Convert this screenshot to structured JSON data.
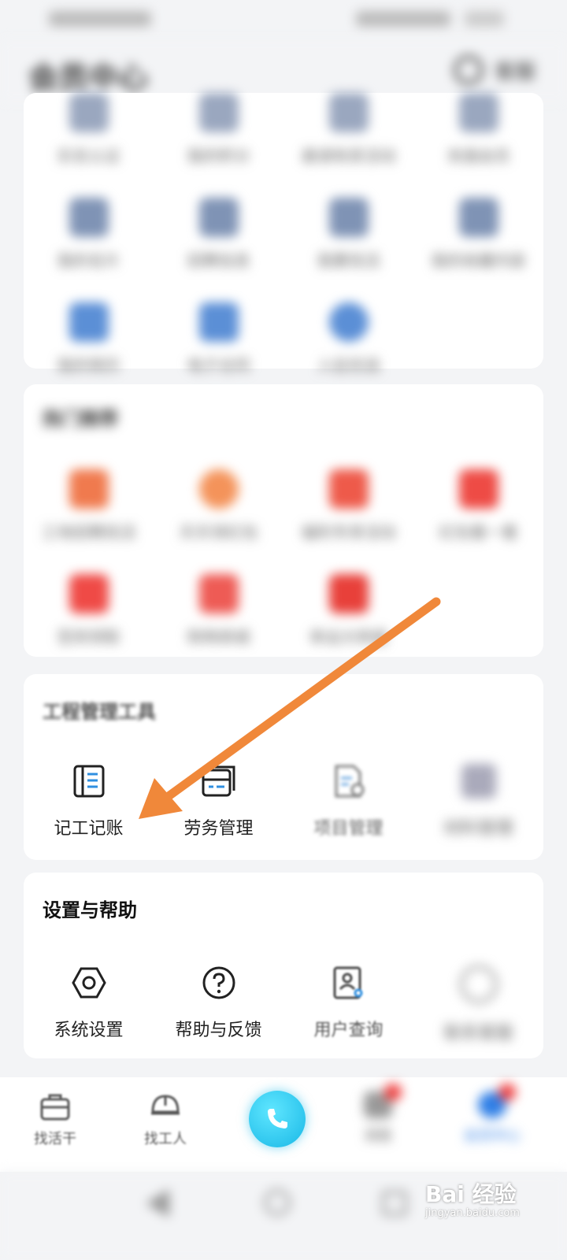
{
  "header": {
    "title": "会员中心",
    "service_label": "客服"
  },
  "section_top": {
    "items": [
      {
        "label": "实名认证",
        "color": "#9aa7bf"
      },
      {
        "label": "我的积分",
        "color": "#9aa7bf"
      },
      {
        "label": "邀请有奖活动",
        "color": "#9aa7bf"
      },
      {
        "label": "充值会员",
        "color": "#9aa7bf"
      },
      {
        "label": "我的名片",
        "color": "#7f93b5"
      },
      {
        "label": "招聘信息",
        "color": "#7f93b5"
      },
      {
        "label": "我要找活",
        "color": "#7f93b5"
      },
      {
        "label": "我的收藏内容",
        "color": "#7f93b5"
      },
      {
        "label": "我的简历",
        "color": "#5b8fd6"
      },
      {
        "label": "电子合同",
        "color": "#5b8fd6"
      },
      {
        "label": "入驻优选",
        "color": "#5b8fd6"
      }
    ]
  },
  "section_featured": {
    "title": "热门推荐",
    "items": [
      {
        "label": "工地招聘找活",
        "color": "#f07a4e"
      },
      {
        "label": "天天领红包",
        "color": "#f4935a"
      },
      {
        "label": "福利专享活动",
        "color": "#ee5a4a"
      },
      {
        "label": "红包看一看",
        "color": "#ee4b45"
      },
      {
        "label": "签到领取",
        "color": "#ef4a46"
      },
      {
        "label": "购物商城",
        "color": "#ee5b55"
      },
      {
        "label": "幸运大转盘",
        "color": "#e8403a"
      }
    ]
  },
  "section_tools": {
    "title": "工程管理工具",
    "items": [
      {
        "label": "记工记账",
        "icon": "ledger-icon"
      },
      {
        "label": "劳务管理",
        "icon": "labor-card-icon"
      },
      {
        "label": "项目管理",
        "icon": "project-doc-icon"
      },
      {
        "label": "材料管理",
        "icon": "material-icon"
      }
    ]
  },
  "section_settings": {
    "title": "设置与帮助",
    "items": [
      {
        "label": "系统设置",
        "icon": "hex-nut-icon"
      },
      {
        "label": "帮助与反馈",
        "icon": "question-circle-icon"
      },
      {
        "label": "用户查询",
        "icon": "user-search-icon"
      },
      {
        "label": "联系客服",
        "icon": "headset-icon"
      }
    ]
  },
  "tabbar": {
    "items": [
      {
        "label": "找活干"
      },
      {
        "label": "找工人"
      },
      {
        "label": "消息"
      },
      {
        "label": "会员中心"
      }
    ]
  },
  "watermark": {
    "brand": "Bai 经验",
    "url": "jingyan.baidu.com"
  },
  "accent_color": "#f0883a"
}
